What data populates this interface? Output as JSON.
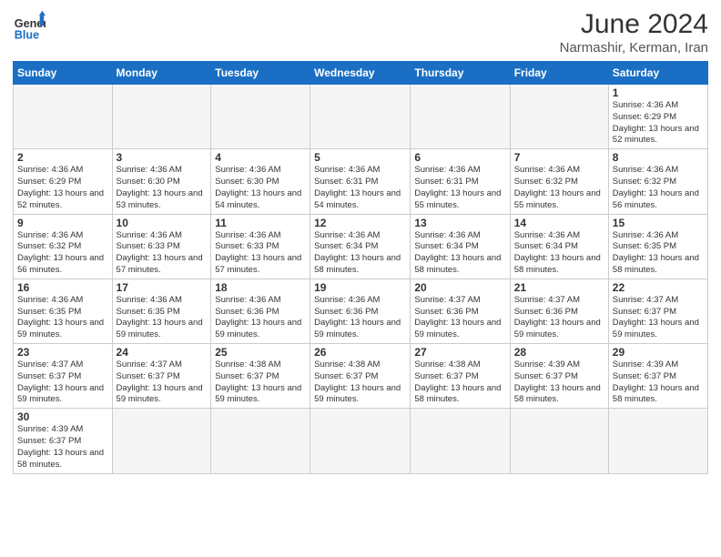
{
  "logo": {
    "text_general": "General",
    "text_blue": "Blue"
  },
  "title": "June 2024",
  "subtitle": "Narmashir, Kerman, Iran",
  "weekdays": [
    "Sunday",
    "Monday",
    "Tuesday",
    "Wednesday",
    "Thursday",
    "Friday",
    "Saturday"
  ],
  "weeks": [
    [
      {
        "day": "",
        "info": ""
      },
      {
        "day": "",
        "info": ""
      },
      {
        "day": "",
        "info": ""
      },
      {
        "day": "",
        "info": ""
      },
      {
        "day": "",
        "info": ""
      },
      {
        "day": "",
        "info": ""
      },
      {
        "day": "1",
        "info": "Sunrise: 4:36 AM\nSunset: 6:29 PM\nDaylight: 13 hours and 52 minutes."
      }
    ],
    [
      {
        "day": "2",
        "info": "Sunrise: 4:36 AM\nSunset: 6:29 PM\nDaylight: 13 hours and 52 minutes."
      },
      {
        "day": "3",
        "info": "Sunrise: 4:36 AM\nSunset: 6:30 PM\nDaylight: 13 hours and 53 minutes."
      },
      {
        "day": "4",
        "info": "Sunrise: 4:36 AM\nSunset: 6:30 PM\nDaylight: 13 hours and 54 minutes."
      },
      {
        "day": "5",
        "info": "Sunrise: 4:36 AM\nSunset: 6:31 PM\nDaylight: 13 hours and 54 minutes."
      },
      {
        "day": "6",
        "info": "Sunrise: 4:36 AM\nSunset: 6:31 PM\nDaylight: 13 hours and 55 minutes."
      },
      {
        "day": "7",
        "info": "Sunrise: 4:36 AM\nSunset: 6:32 PM\nDaylight: 13 hours and 55 minutes."
      },
      {
        "day": "8",
        "info": "Sunrise: 4:36 AM\nSunset: 6:32 PM\nDaylight: 13 hours and 56 minutes."
      }
    ],
    [
      {
        "day": "9",
        "info": "Sunrise: 4:36 AM\nSunset: 6:32 PM\nDaylight: 13 hours and 56 minutes."
      },
      {
        "day": "10",
        "info": "Sunrise: 4:36 AM\nSunset: 6:33 PM\nDaylight: 13 hours and 57 minutes."
      },
      {
        "day": "11",
        "info": "Sunrise: 4:36 AM\nSunset: 6:33 PM\nDaylight: 13 hours and 57 minutes."
      },
      {
        "day": "12",
        "info": "Sunrise: 4:36 AM\nSunset: 6:34 PM\nDaylight: 13 hours and 58 minutes."
      },
      {
        "day": "13",
        "info": "Sunrise: 4:36 AM\nSunset: 6:34 PM\nDaylight: 13 hours and 58 minutes."
      },
      {
        "day": "14",
        "info": "Sunrise: 4:36 AM\nSunset: 6:34 PM\nDaylight: 13 hours and 58 minutes."
      },
      {
        "day": "15",
        "info": "Sunrise: 4:36 AM\nSunset: 6:35 PM\nDaylight: 13 hours and 58 minutes."
      }
    ],
    [
      {
        "day": "16",
        "info": "Sunrise: 4:36 AM\nSunset: 6:35 PM\nDaylight: 13 hours and 59 minutes."
      },
      {
        "day": "17",
        "info": "Sunrise: 4:36 AM\nSunset: 6:35 PM\nDaylight: 13 hours and 59 minutes."
      },
      {
        "day": "18",
        "info": "Sunrise: 4:36 AM\nSunset: 6:36 PM\nDaylight: 13 hours and 59 minutes."
      },
      {
        "day": "19",
        "info": "Sunrise: 4:36 AM\nSunset: 6:36 PM\nDaylight: 13 hours and 59 minutes."
      },
      {
        "day": "20",
        "info": "Sunrise: 4:37 AM\nSunset: 6:36 PM\nDaylight: 13 hours and 59 minutes."
      },
      {
        "day": "21",
        "info": "Sunrise: 4:37 AM\nSunset: 6:36 PM\nDaylight: 13 hours and 59 minutes."
      },
      {
        "day": "22",
        "info": "Sunrise: 4:37 AM\nSunset: 6:37 PM\nDaylight: 13 hours and 59 minutes."
      }
    ],
    [
      {
        "day": "23",
        "info": "Sunrise: 4:37 AM\nSunset: 6:37 PM\nDaylight: 13 hours and 59 minutes."
      },
      {
        "day": "24",
        "info": "Sunrise: 4:37 AM\nSunset: 6:37 PM\nDaylight: 13 hours and 59 minutes."
      },
      {
        "day": "25",
        "info": "Sunrise: 4:38 AM\nSunset: 6:37 PM\nDaylight: 13 hours and 59 minutes."
      },
      {
        "day": "26",
        "info": "Sunrise: 4:38 AM\nSunset: 6:37 PM\nDaylight: 13 hours and 59 minutes."
      },
      {
        "day": "27",
        "info": "Sunrise: 4:38 AM\nSunset: 6:37 PM\nDaylight: 13 hours and 58 minutes."
      },
      {
        "day": "28",
        "info": "Sunrise: 4:39 AM\nSunset: 6:37 PM\nDaylight: 13 hours and 58 minutes."
      },
      {
        "day": "29",
        "info": "Sunrise: 4:39 AM\nSunset: 6:37 PM\nDaylight: 13 hours and 58 minutes."
      }
    ],
    [
      {
        "day": "30",
        "info": "Sunrise: 4:39 AM\nSunset: 6:37 PM\nDaylight: 13 hours and 58 minutes."
      },
      {
        "day": "",
        "info": ""
      },
      {
        "day": "",
        "info": ""
      },
      {
        "day": "",
        "info": ""
      },
      {
        "day": "",
        "info": ""
      },
      {
        "day": "",
        "info": ""
      },
      {
        "day": "",
        "info": ""
      }
    ]
  ]
}
